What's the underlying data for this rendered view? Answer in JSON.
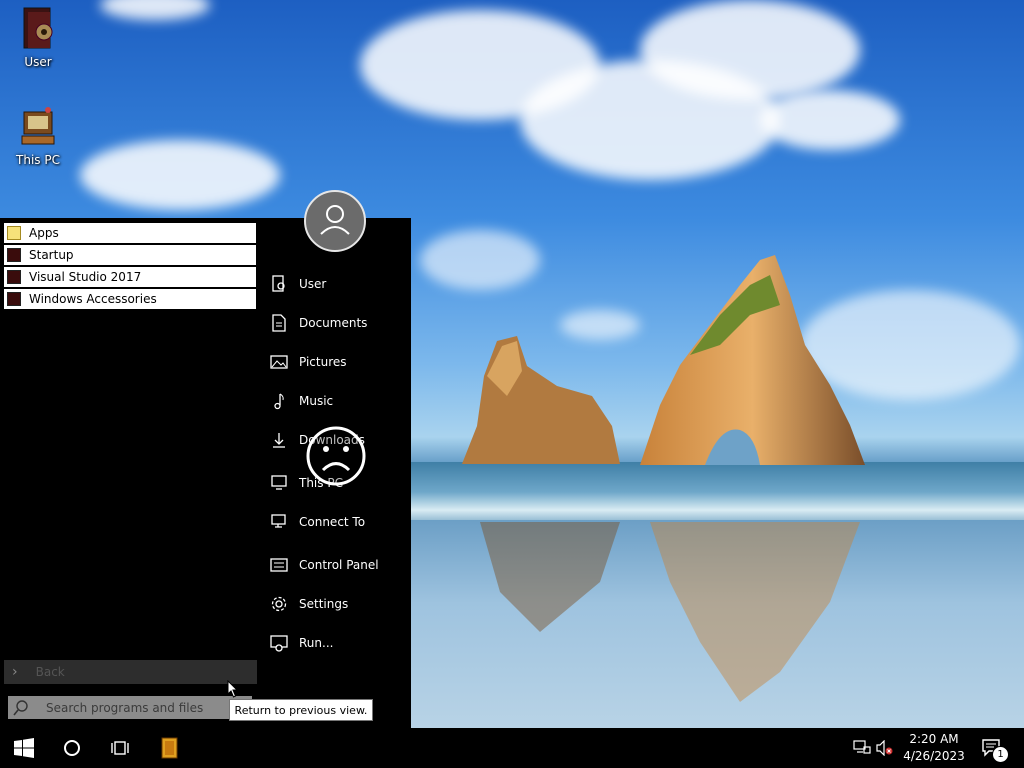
{
  "desktop": {
    "icons": [
      {
        "label": "User",
        "icon": "user-folder-icon"
      },
      {
        "label": "This PC",
        "icon": "computer-icon"
      }
    ]
  },
  "start_menu": {
    "programs": [
      {
        "label": "Apps",
        "icon": "apps-icon"
      },
      {
        "label": "Startup",
        "icon": "folder-icon"
      },
      {
        "label": "Visual Studio 2017",
        "icon": "folder-icon"
      },
      {
        "label": "Windows Accessories",
        "icon": "folder-icon"
      }
    ],
    "side_items": [
      {
        "label": "User",
        "icon": "user-icon"
      },
      {
        "label": "Documents",
        "icon": "documents-icon"
      },
      {
        "label": "Pictures",
        "icon": "pictures-icon"
      },
      {
        "label": "Music",
        "icon": "music-icon"
      },
      {
        "label": "Downloads",
        "icon": "download-icon"
      },
      {
        "label": "This PC",
        "icon": "computer-icon"
      },
      {
        "label": "Connect To",
        "icon": "connect-icon"
      },
      {
        "label": "Control Panel",
        "icon": "control-panel-icon"
      },
      {
        "label": "Settings",
        "icon": "gear-icon"
      },
      {
        "label": "Run...",
        "icon": "run-icon"
      }
    ],
    "back_label": "Back",
    "search_placeholder": "Search programs and files",
    "tooltip": "Return to previous view."
  },
  "taskbar": {
    "time": "2:20 AM",
    "date": "4/26/2023",
    "notification_count": "1"
  },
  "colors": {
    "menu_bg": "#000000",
    "program_item_bg": "#ffffff",
    "search_bg": "#8b8b8b"
  }
}
